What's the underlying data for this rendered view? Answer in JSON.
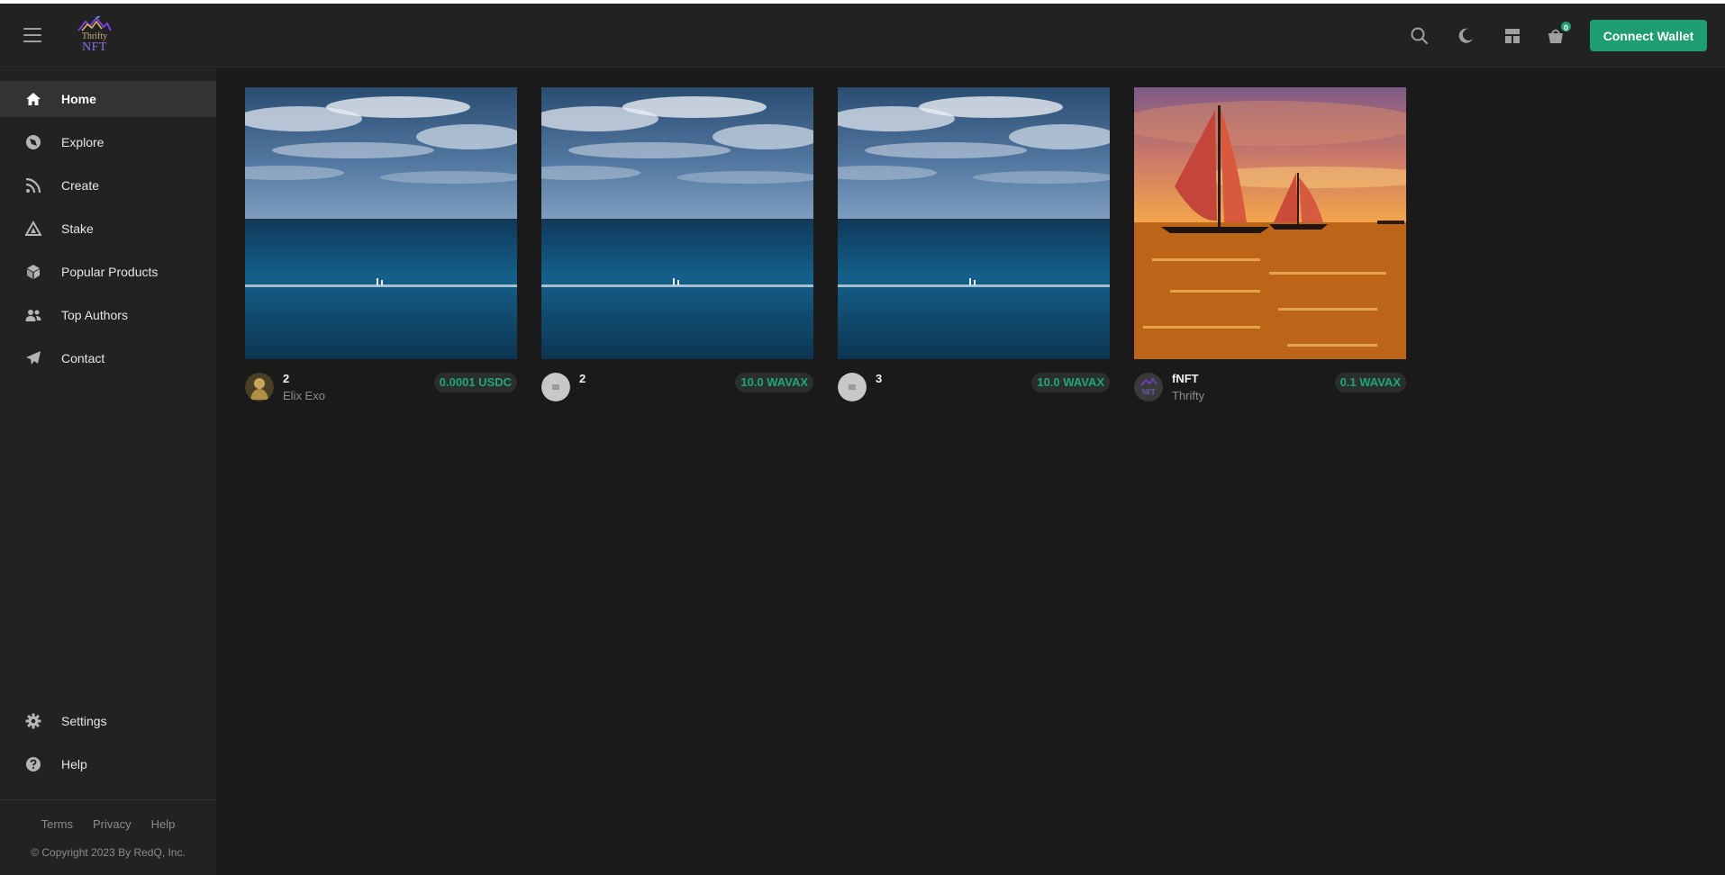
{
  "header": {
    "logo_top": "Thrifty",
    "logo_bottom": "NFT",
    "cart_count": "0",
    "connect_label": "Connect Wallet",
    "icons": [
      "menu-icon",
      "search-icon",
      "moon-icon",
      "layout-icon",
      "cart-icon"
    ]
  },
  "sidebar": {
    "items": [
      {
        "label": "Home",
        "icon": "home-icon",
        "active": true
      },
      {
        "label": "Explore",
        "icon": "compass-icon"
      },
      {
        "label": "Create",
        "icon": "rss-icon"
      },
      {
        "label": "Stake",
        "icon": "triangle-icon"
      },
      {
        "label": "Popular Products",
        "icon": "cube-icon"
      },
      {
        "label": "Top Authors",
        "icon": "users-icon"
      },
      {
        "label": "Contact",
        "icon": "paper-plane-icon"
      }
    ],
    "bottom_items": [
      {
        "label": "Settings",
        "icon": "gear-icon"
      },
      {
        "label": "Help",
        "icon": "help-circle-icon"
      }
    ],
    "footer_links": [
      "Terms",
      "Privacy",
      "Help"
    ],
    "copyright": "© Copyright 2023 By RedQ, Inc."
  },
  "cards": [
    {
      "title": "2",
      "author": "Elix Exo",
      "price": "0.0001 USDC",
      "image": "ocean-horizon"
    },
    {
      "title": "2",
      "author": "",
      "price": "10.0 WAVAX",
      "image": "ocean-horizon"
    },
    {
      "title": "3",
      "author": "",
      "price": "10.0 WAVAX",
      "image": "ocean-horizon"
    },
    {
      "title": "fNFT",
      "author": "Thrifty",
      "price": "0.1 WAVAX",
      "image": "sailboats-sunset"
    }
  ],
  "colors": {
    "accent": "#1f9d72",
    "background": "#1a1a1a",
    "panel": "#222222"
  }
}
